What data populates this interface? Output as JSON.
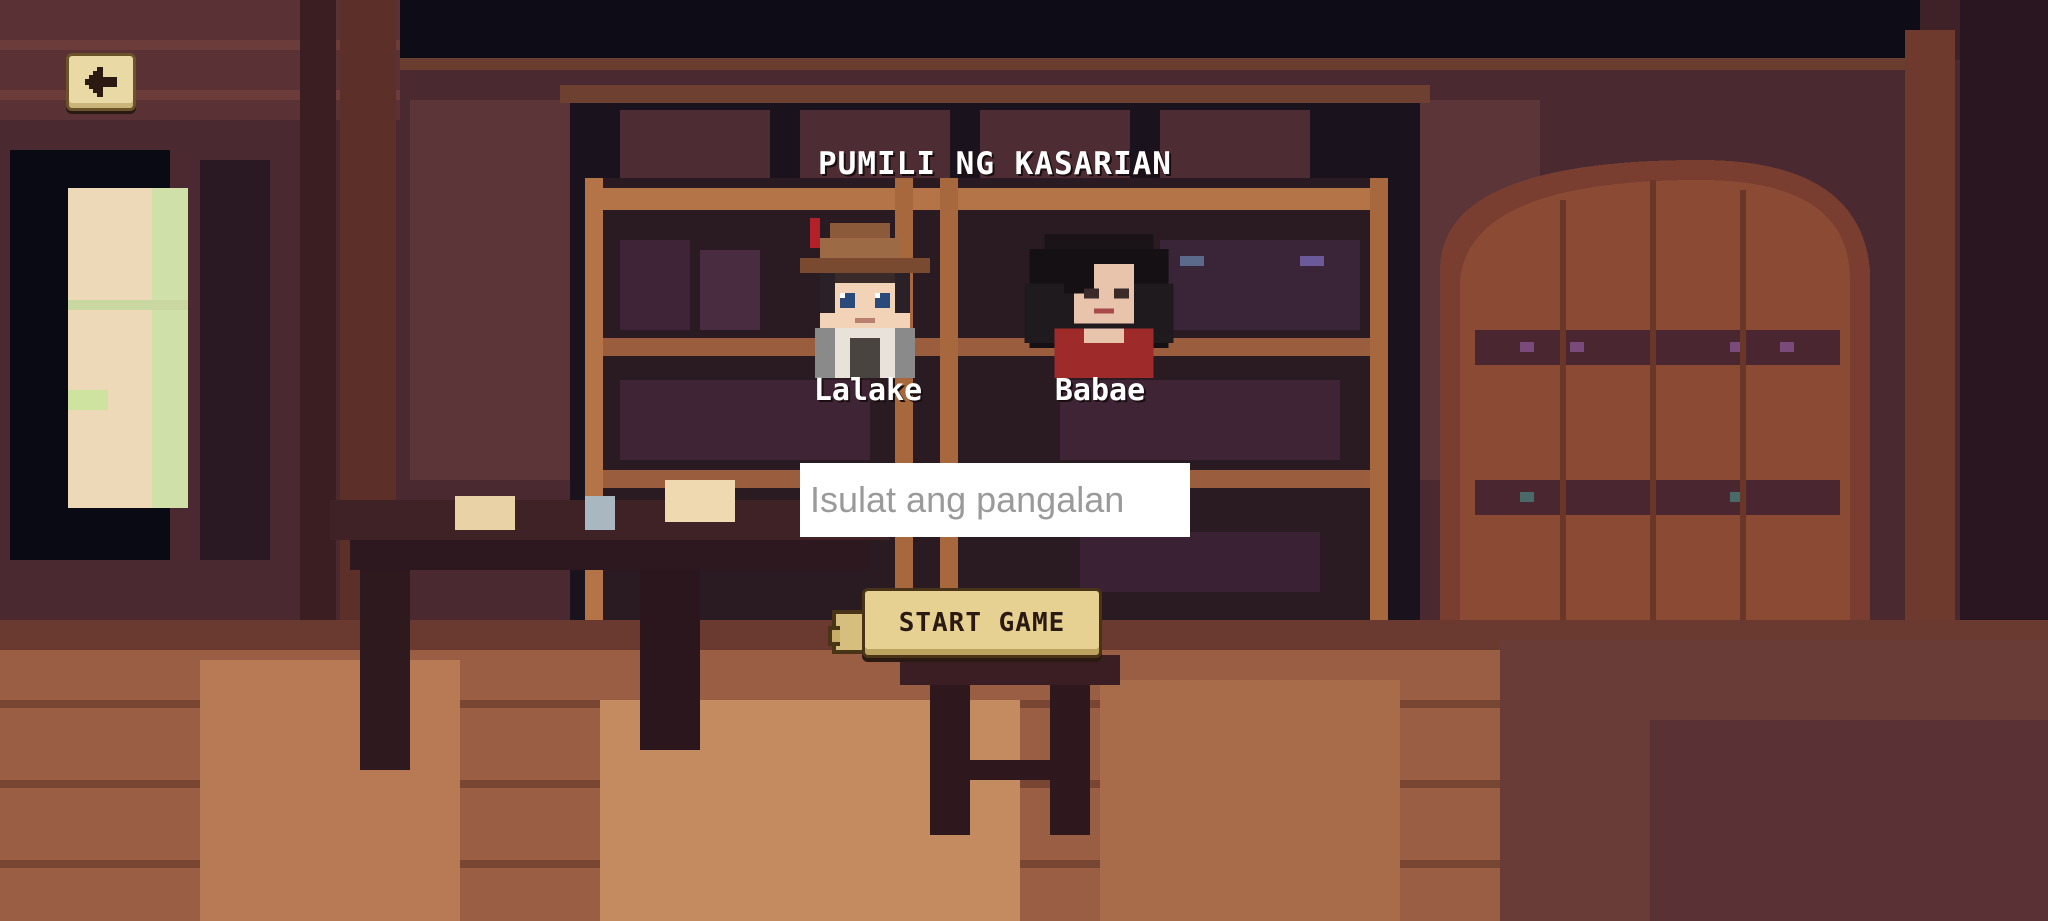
{
  "screen": {
    "title": "PUMILI NG KASARIAN",
    "back_icon": "arrow-left-icon"
  },
  "characters": [
    {
      "label": "Lalake",
      "icon": "male-character-icon"
    },
    {
      "label": "Babae",
      "icon": "female-character-icon"
    }
  ],
  "name_input": {
    "placeholder": "Isulat ang pangalan",
    "value": ""
  },
  "start_button": {
    "label": "START GAME"
  },
  "colors": {
    "button_face": "#e6d193",
    "button_border": "#4a3418",
    "title_text": "#ffffff",
    "background": "#3a2228"
  }
}
